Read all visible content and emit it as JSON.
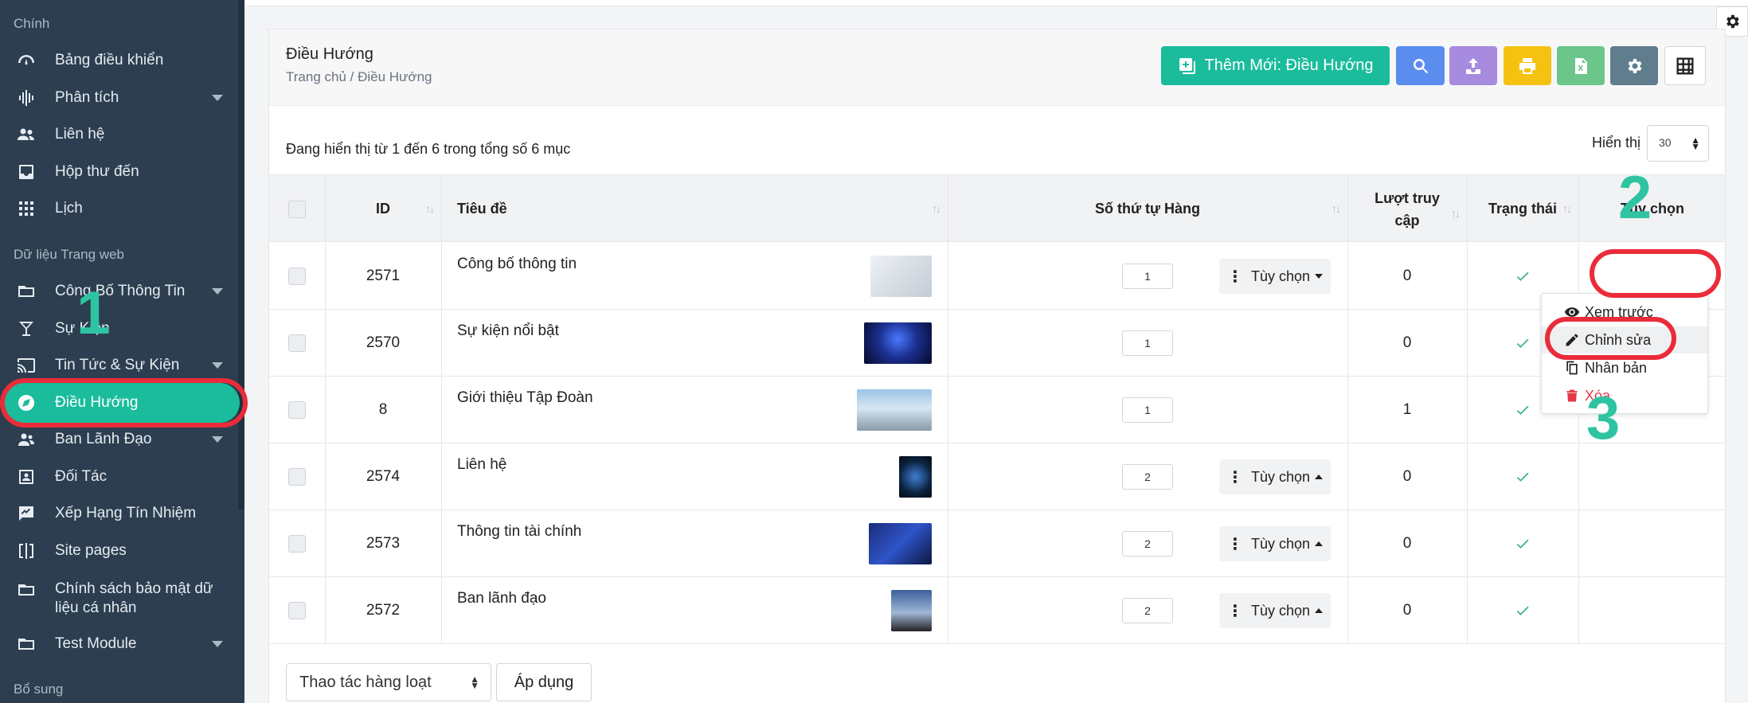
{
  "sidebar": {
    "section_main": "Chính",
    "section_data": "Dữ liệu Trang web",
    "section_extra": "Bổ sung",
    "items": [
      {
        "label": "Bảng điều khiển"
      },
      {
        "label": "Phân tích"
      },
      {
        "label": "Liên hệ"
      },
      {
        "label": "Hộp thư đến"
      },
      {
        "label": "Lịch"
      },
      {
        "label": "Công Bố Thông Tin"
      },
      {
        "label": "Sự Kiện"
      },
      {
        "label": "Tin Tức & Sự Kiện"
      },
      {
        "label": "Điều Hướng"
      },
      {
        "label": "Ban Lãnh Đạo"
      },
      {
        "label": "Đối Tác"
      },
      {
        "label": "Xếp Hạng Tín Nhiệm"
      },
      {
        "label": "Site pages"
      },
      {
        "label": "Chính sách bảo mật dữ liệu cá nhân"
      },
      {
        "label": "Test Module"
      }
    ]
  },
  "header": {
    "title": "Điều Hướng",
    "breadcrumb": "Trang chủ / Điều Hướng",
    "add_button": "Thêm Mới: Điều Hướng"
  },
  "list": {
    "summary": "Đang hiển thị từ 1 đến 6 trong tổng số 6 mục",
    "per_page_label": "Hiển thị",
    "per_page_value": "30"
  },
  "table": {
    "columns": [
      "ID",
      "Tiêu đề",
      "Số thứ tự Hàng",
      "Lượt truy cập",
      "Trạng thái",
      "Tùy chọn"
    ],
    "option_label": "Tùy chọn",
    "rows": [
      {
        "id": "2571",
        "title": "Công bố thông tin",
        "order": "1",
        "views": "0"
      },
      {
        "id": "2570",
        "title": "Sự kiện nổi bật",
        "order": "1",
        "views": "0"
      },
      {
        "id": "8",
        "title": "Giới thiệu Tập Đoàn",
        "order": "1",
        "views": "1"
      },
      {
        "id": "2574",
        "title": "Liên hệ",
        "order": "2",
        "views": "0"
      },
      {
        "id": "2573",
        "title": "Thông tin tài chính",
        "order": "2",
        "views": "0"
      },
      {
        "id": "2572",
        "title": "Ban lãnh đạo",
        "order": "2",
        "views": "0"
      }
    ]
  },
  "dropdown": {
    "preview": "Xem trước",
    "edit": "Chỉnh sửa",
    "duplicate": "Nhân bản",
    "delete": "Xóa"
  },
  "footer": {
    "bulk_action": "Thao tác hàng loạt",
    "apply": "Áp dụng"
  },
  "annotations": {
    "one": "1",
    "two": "2",
    "three": "3"
  },
  "colors": {
    "sidebar_bg": "#2c3e50",
    "accent": "#1abc9c",
    "highlight_ring": "#ea2c3a",
    "annotation_number": "#2ec4a2",
    "status_ok": "#36b37e",
    "danger": "#e53945"
  }
}
